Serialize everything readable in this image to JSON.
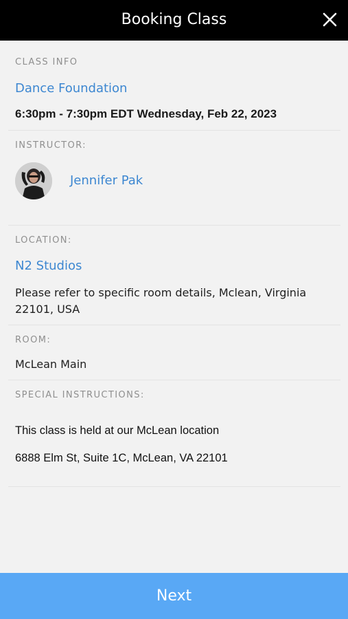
{
  "header": {
    "title": "Booking Class",
    "close_icon": "close-icon"
  },
  "class_info": {
    "label": "CLASS INFO",
    "name": "Dance Foundation",
    "schedule": "6:30pm - 7:30pm EDT Wednesday, Feb 22, 2023"
  },
  "instructor": {
    "label": "INSTRUCTOR:",
    "name": "Jennifer Pak",
    "avatar": "instructor-avatar"
  },
  "location": {
    "label": "LOCATION:",
    "name": "N2 Studios",
    "address": "Please refer to specific room details, Mclean, Virginia 22101, USA"
  },
  "room": {
    "label": "ROOM:",
    "name": "McLean Main"
  },
  "special_instructions": {
    "label": "SPECIAL INSTRUCTIONS:",
    "line1": "This class is held at our McLean location",
    "line2": "6888 Elm St, Suite 1C, McLean, VA 22101"
  },
  "footer": {
    "next_label": "Next"
  },
  "colors": {
    "header_bg": "#000000",
    "link": "#3d87d1",
    "next_button": "#59a8f5",
    "page_bg": "#f2f2f2"
  }
}
